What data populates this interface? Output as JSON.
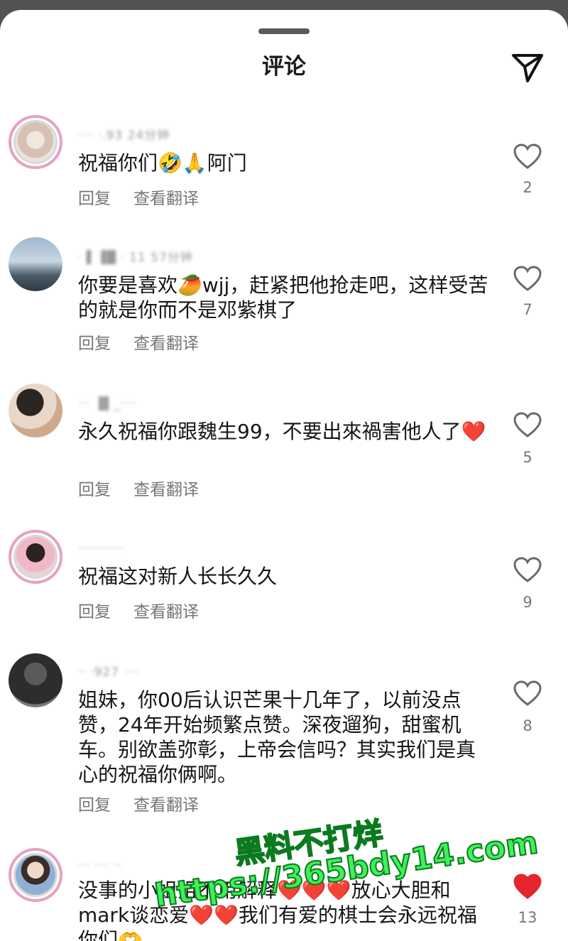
{
  "header": {
    "title": "评论"
  },
  "actions": {
    "reply_label": "回复",
    "translate_label": "查看翻译"
  },
  "comments": [
    {
      "username": "ᐧᐧᐧᐧ ᐧ.93 24分钟",
      "text": "祝福你们🤣🙏阿门",
      "likes": "2",
      "liked": false
    },
    {
      "username": "ᐧ ▌▐█ ᐧ 11 57分钟",
      "text": "你要是喜欢🥭wjj，赶紧把他抢走吧，这样受苦的就是你而不是邓紫棋了",
      "likes": "7",
      "liked": false
    },
    {
      "username": "ᐧᐧᐧ ▐▌_ᐧᐧᐧᐧ",
      "text": "永久祝福你跟魏生99，不要出來禍害他人了❤️",
      "likes": "5",
      "liked": false
    },
    {
      "username": "ᐧᐧᐧᐧᐧᐧᐧᐧᐧᐧᐧᐧ",
      "text": "祝福这对新人长长久久",
      "likes": "9",
      "liked": false
    },
    {
      "username": "ᐧᐧ ᐧ927 ᐧᐧᐧᐧ",
      "text": "姐妹，你00后认识芒果十几年了，以前没点赞，24年开始频繁点赞。深夜遛狗，甜蜜机车。别欲盖弥彰，上帝会信吗？其实我们是真心的祝福你俩啊。",
      "likes": "8",
      "liked": false
    },
    {
      "username": "ᐧᐧᐧ ᐧᐧᐧᐧ ᐧᐧ",
      "text": "没事的小姐姐不用解释❤️❤️❤️放心大胆和mark谈恋爱❤️❤️我们有爱的棋士会永远祝福你们🫶",
      "likes": "13",
      "liked": true
    }
  ],
  "watermark": {
    "line1": "黑料不打烊",
    "line2": "https://365bdy14.com"
  },
  "colors": {
    "accent_like": "#e5262c",
    "watermark": "#3ff05a",
    "avatar_ring": "#e5a3c3"
  }
}
